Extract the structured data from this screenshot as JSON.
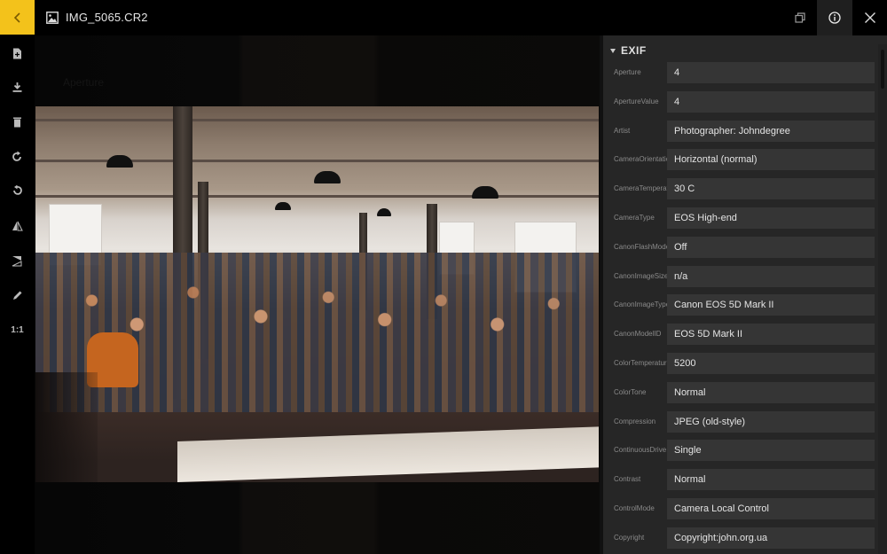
{
  "header": {
    "file_title": "IMG_5065.CR2",
    "back_icon": "chevron-left-icon",
    "file_icon": "image-icon",
    "buttons": [
      {
        "name": "restore-window",
        "icon": "restore-window-icon"
      },
      {
        "name": "info",
        "icon": "info-icon",
        "active": true
      },
      {
        "name": "close",
        "icon": "close-icon"
      }
    ]
  },
  "colors": {
    "accent": "#f3c21b",
    "panel_bg": "#262626",
    "field_bg": "#353535",
    "label_text": "#8a8a8a",
    "value_text": "#e4e4e4"
  },
  "sidebar": {
    "items": [
      {
        "name": "new-file",
        "icon": "file-add-icon"
      },
      {
        "name": "download",
        "icon": "download-icon"
      },
      {
        "name": "delete",
        "icon": "trash-icon"
      },
      {
        "name": "rotate-right",
        "icon": "rotate-cw-icon"
      },
      {
        "name": "rotate-left",
        "icon": "rotate-ccw-icon"
      },
      {
        "name": "flip-vertical",
        "icon": "flip-vertical-icon"
      },
      {
        "name": "flip-horizontal",
        "icon": "flip-horizontal-icon"
      },
      {
        "name": "edit",
        "icon": "pencil-icon"
      },
      {
        "name": "actual-size",
        "icon": "one-to-one-icon",
        "label": "1:1"
      }
    ]
  },
  "viewer": {
    "background_hint": "Aperture",
    "photo_alt": "Conference audience seated in an industrial loft hall"
  },
  "panel": {
    "section_title": "EXIF",
    "rows": [
      {
        "key": "Aperture",
        "value": "4"
      },
      {
        "key": "ApertureValue",
        "value": "4"
      },
      {
        "key": "Artist",
        "value": "Photographer: Johndegree"
      },
      {
        "key": "CameraOrientation",
        "value": "Horizontal (normal)"
      },
      {
        "key": "CameraTemperature",
        "value": "30 C"
      },
      {
        "key": "CameraType",
        "value": "EOS High-end"
      },
      {
        "key": "CanonFlashMode",
        "value": "Off"
      },
      {
        "key": "CanonImageSize",
        "value": "n/a"
      },
      {
        "key": "CanonImageType",
        "value": "Canon EOS 5D Mark II"
      },
      {
        "key": "CanonModelID",
        "value": "EOS 5D Mark II"
      },
      {
        "key": "ColorTemperature",
        "value": "5200"
      },
      {
        "key": "ColorTone",
        "value": "Normal"
      },
      {
        "key": "Compression",
        "value": "JPEG (old-style)"
      },
      {
        "key": "ContinuousDrive",
        "value": "Single"
      },
      {
        "key": "Contrast",
        "value": "Normal"
      },
      {
        "key": "ControlMode",
        "value": "Camera Local Control"
      },
      {
        "key": "Copyright",
        "value": "Copyright:john.org.ua"
      }
    ]
  }
}
